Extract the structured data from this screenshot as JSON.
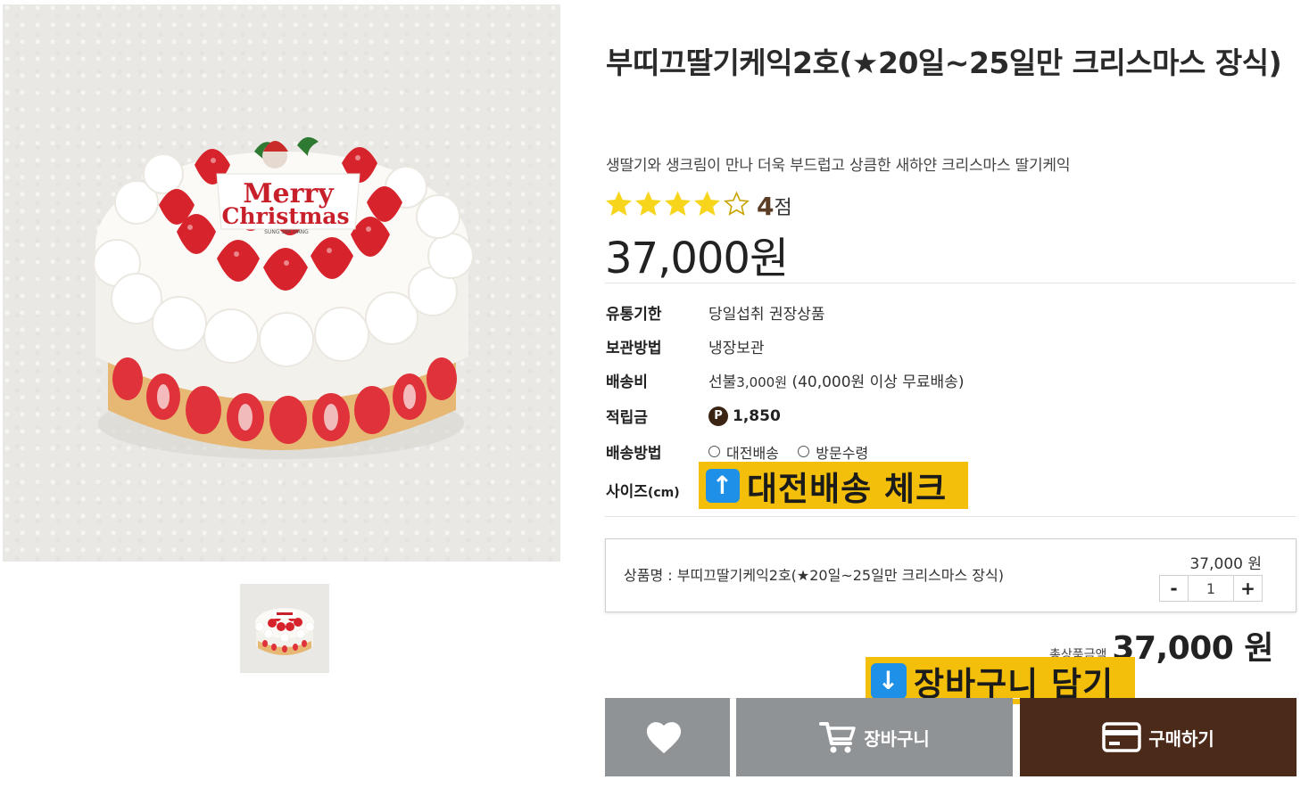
{
  "product": {
    "title": "부띠끄딸기케익2호(★20일~25일만 크리스마스 장식)",
    "subtitle": "생딸기와 생크림이 만나 더욱 부드럽고 상큼한 새하얀 크리스마스 딸기케익",
    "rating": {
      "stars_filled": 4,
      "stars_total": 5,
      "score": "4",
      "unit": "점"
    },
    "price": "37,000원"
  },
  "image": {
    "topper_line1": "Merry",
    "topper_line2": "Christmas",
    "topper_brand": "SUNG SIM DANG"
  },
  "info": {
    "expiry_label": "유통기한",
    "expiry_value": "당일섭취 권장상품",
    "storage_label": "보관방법",
    "storage_value": "냉장보관",
    "shipping_fee_label": "배송비",
    "shipping_fee_prefix": "선불",
    "shipping_fee_amount": "3,000원",
    "shipping_fee_note": "(40,000원 이상 무료배송)",
    "points_label": "적립금",
    "points_badge": "P",
    "points_value": "1,850",
    "method_label": "배송방법",
    "method_options": [
      "대전배송",
      "방문수령"
    ],
    "size_label": "사이즈",
    "size_unit": "(cm)"
  },
  "annotations": {
    "check_delivery": "대전배송 체크",
    "add_to_cart": "장바구니 담기",
    "up_arrow": "↑",
    "down_arrow": "↓"
  },
  "selected_option": {
    "name": "상품명 : 부띠끄딸기케익2호(★20일~25일만 크리스마스 장식)",
    "price": "37,000 원",
    "qty_minus": "-",
    "qty_value": "1",
    "qty_plus": "+"
  },
  "total": {
    "label": "총상품금액",
    "value": "37,000 원"
  },
  "buttons": {
    "wishlist_icon": "heart-icon",
    "cart": "장바구니",
    "buy": "구매하기"
  },
  "colors": {
    "star": "#f7d51d",
    "buy_button": "#4b2a1a",
    "grey_button": "#8f9396",
    "callout": "#f3bf0a",
    "callout_arrow": "#1e90e8"
  }
}
